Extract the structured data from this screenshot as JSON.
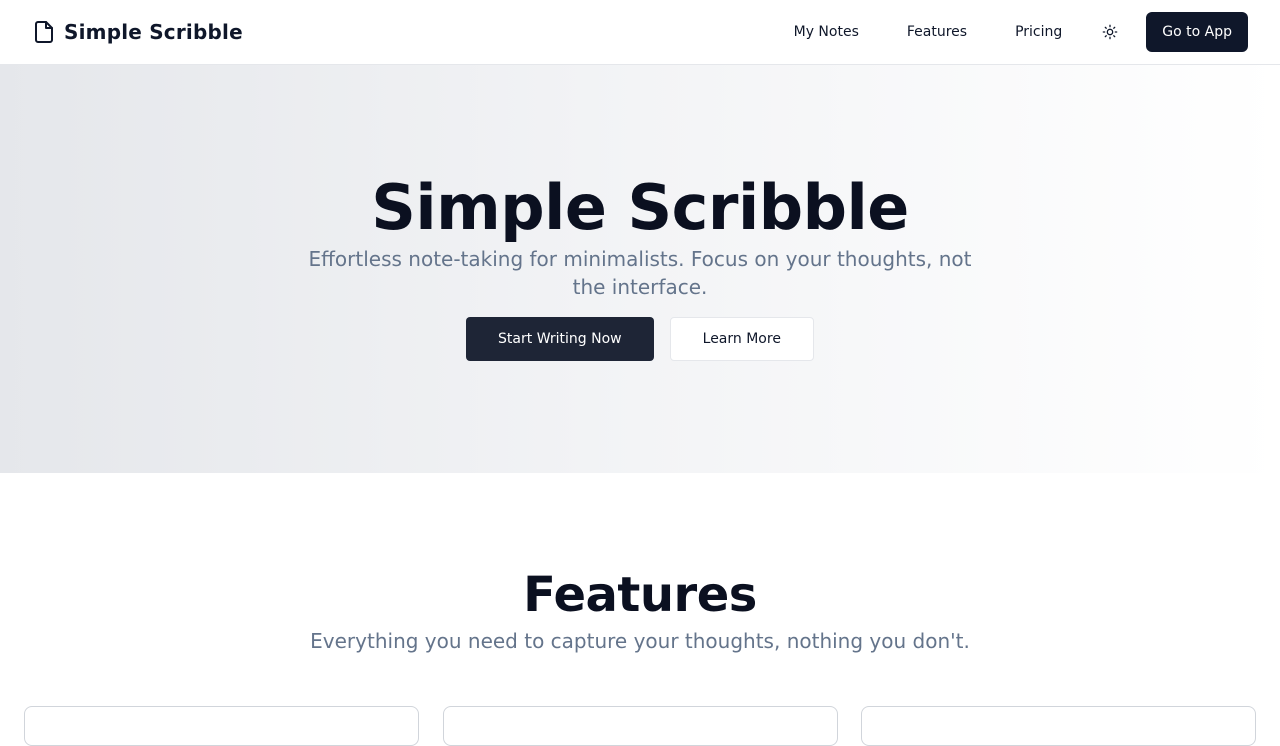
{
  "header": {
    "brand_name": "Simple Scribble",
    "brand_icon": "file-icon",
    "nav": [
      {
        "label": "My Notes"
      },
      {
        "label": "Features"
      },
      {
        "label": "Pricing"
      }
    ],
    "theme_icon": "sun-icon",
    "cta_label": "Go to App"
  },
  "hero": {
    "title": "Simple Scribble",
    "subtitle": "Effortless note-taking for minimalists. Focus on your thoughts, not the interface.",
    "primary_label": "Start Writing Now",
    "secondary_label": "Learn More"
  },
  "features": {
    "title": "Features",
    "subtitle": "Everything you need to capture your thoughts, nothing you don't."
  },
  "colors": {
    "primary_dark": "#0f172a",
    "button_dark": "#1e2536",
    "muted_text": "#64748b",
    "border": "#e5e7eb"
  }
}
